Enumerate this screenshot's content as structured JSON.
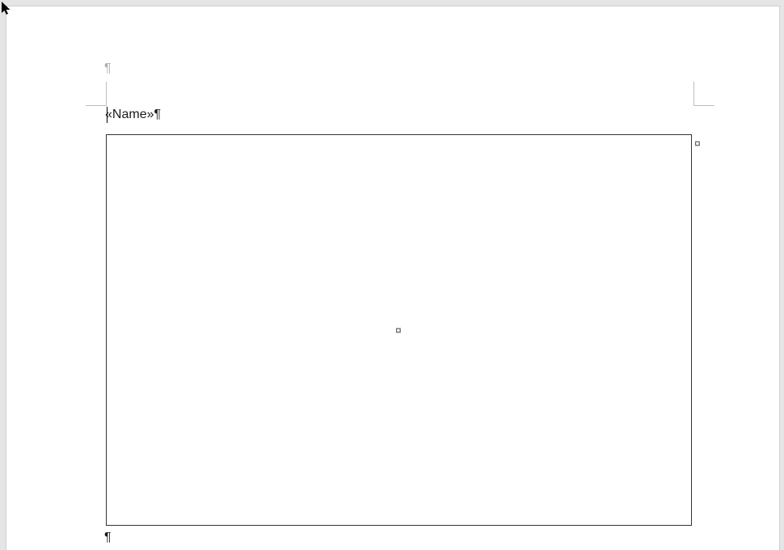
{
  "glyphs": {
    "pilcrow": "¶",
    "end_cell": "¤"
  },
  "header": {
    "pilcrow": "¶"
  },
  "merge_field": {
    "open": "«",
    "name": "Name",
    "close": "»",
    "trailing_pilcrow": "¶"
  },
  "frame": {
    "inside_mark": "¤",
    "outside_mark": "¤"
  },
  "after_frame": {
    "pilcrow": "¶"
  }
}
